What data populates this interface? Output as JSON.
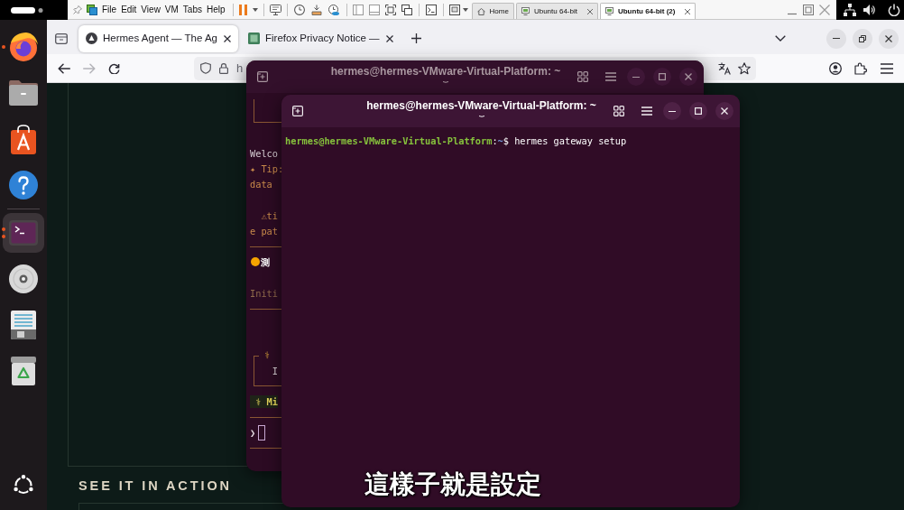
{
  "top_bar": {
    "vm_menu": [
      {
        "label": "File"
      },
      {
        "label": "Edit"
      },
      {
        "label": "View"
      },
      {
        "label": "VM"
      },
      {
        "label": "Tabs"
      },
      {
        "label": "Help"
      }
    ],
    "vm_tabs": [
      {
        "kind": "home",
        "label": "Home",
        "selected": false,
        "closable": false
      },
      {
        "kind": "vm",
        "label": "Ubuntu 64-bit",
        "selected": false,
        "closable": true
      },
      {
        "kind": "vm",
        "label": "Ubuntu 64-bit (2)",
        "selected": true,
        "closable": true
      }
    ]
  },
  "dock": {
    "apps": [
      {
        "kind": "browser",
        "running": true,
        "multiple_windows": false,
        "selected": false,
        "separator_before": false
      },
      {
        "kind": "files",
        "running": false,
        "multiple_windows": false,
        "selected": false,
        "separator_before": false
      },
      {
        "kind": "store",
        "running": false,
        "multiple_windows": false,
        "selected": false,
        "separator_before": false
      },
      {
        "kind": "help",
        "running": false,
        "multiple_windows": false,
        "selected": false,
        "separator_before": false
      },
      {
        "kind": "terminal",
        "running": true,
        "multiple_windows": true,
        "selected": true,
        "separator_before": true
      },
      {
        "kind": "disc",
        "running": false,
        "multiple_windows": false,
        "selected": false,
        "separator_before": false
      },
      {
        "kind": "save",
        "running": false,
        "multiple_windows": false,
        "selected": false,
        "separator_before": false
      },
      {
        "kind": "trash",
        "running": false,
        "multiple_windows": false,
        "selected": false,
        "separator_before": false
      }
    ]
  },
  "browser": {
    "tabs": [
      {
        "kind": "circle",
        "title": "Hermes Agent — The Ag",
        "selected": true
      },
      {
        "kind": "image",
        "title": "Firefox Privacy Notice —",
        "selected": false
      }
    ],
    "nav": [
      {
        "kind": "back",
        "disabled": false
      },
      {
        "kind": "forward",
        "disabled": true
      },
      {
        "kind": "reload",
        "disabled": false
      }
    ],
    "address": "h",
    "page": {
      "heading": "SEE IT IN ACTION"
    }
  },
  "terminals": [
    {
      "title": "hermes@hermes-VMware-Virtual-Platform: ~",
      "focused": false,
      "lines": [
        {
          "kind": "box_side"
        },
        {
          "kind": "box_bottom"
        },
        {
          "kind": "blank"
        },
        {
          "kind": "plain",
          "text": "Welco"
        },
        {
          "kind": "accent",
          "text": "✦ Tip:"
        },
        {
          "kind": "accent",
          "text": "data"
        },
        {
          "kind": "blank"
        },
        {
          "kind": "accent",
          "text": "  ⚠ti"
        },
        {
          "kind": "accent",
          "text": "e pat"
        },
        {
          "kind": "rule"
        },
        {
          "kind": "status",
          "text": "測"
        },
        {
          "kind": "blank"
        },
        {
          "kind": "dim",
          "text": "Initi"
        },
        {
          "kind": "rule"
        },
        {
          "kind": "blank"
        },
        {
          "kind": "blank"
        },
        {
          "kind": "box_top",
          "text": "⚕"
        },
        {
          "kind": "box_side",
          "text": "   I"
        },
        {
          "kind": "box_bottom"
        },
        {
          "kind": "highlight",
          "text": " ⚕ Mi"
        },
        {
          "kind": "rule"
        },
        {
          "kind": "input",
          "text": "❯"
        },
        {
          "kind": "rule"
        }
      ]
    },
    {
      "title": "hermes@hermes-VMware-Virtual-Platform: ~",
      "focused": true,
      "lines": [
        {
          "kind": "prompt",
          "user_host": "hermes@hermes-VMware-Virtual-Platform",
          "separator": ":",
          "path": "~",
          "symbol": "$",
          "command": "hermes gateway setup"
        }
      ]
    }
  ],
  "subtitle": "這樣子就是設定"
}
